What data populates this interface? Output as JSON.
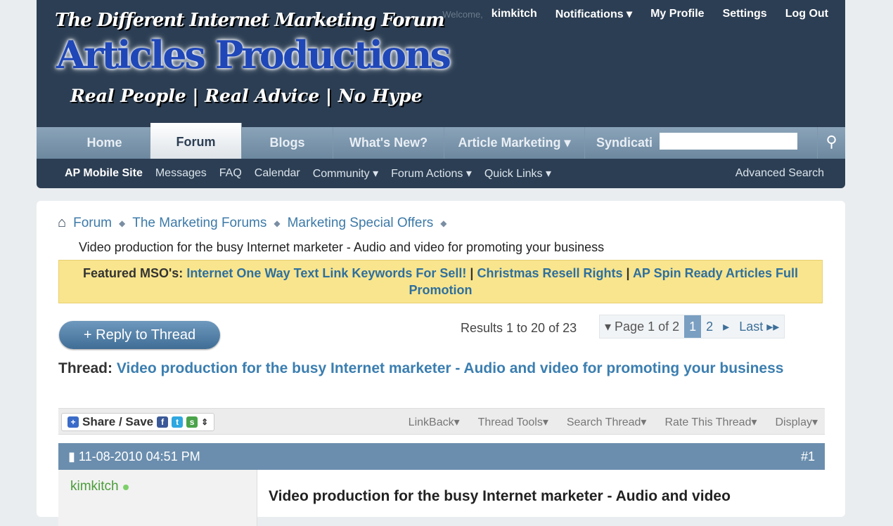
{
  "header": {
    "tagline_top": "The Different Internet Marketing Forum",
    "logo": "Articles Productions",
    "tagline_bottom": "Real People | Real Advice | No Hype",
    "welcome": "Welcome,",
    "username": "kimkitch",
    "notifications": "Notifications ▾",
    "my_profile": "My Profile",
    "settings": "Settings",
    "logout": "Log Out"
  },
  "nav": {
    "items": [
      "Home",
      "Forum",
      "Blogs",
      "What's New?",
      "Article Marketing ▾",
      "Syndicati"
    ],
    "search_placeholder": ""
  },
  "subnav": {
    "items": [
      "AP Mobile Site",
      "Messages",
      "FAQ",
      "Calendar",
      "Community ▾",
      "Forum Actions ▾",
      "Quick Links ▾"
    ],
    "advanced_search": "Advanced Search"
  },
  "breadcrumb": {
    "items": [
      "Forum",
      "The Marketing Forums",
      "Marketing Special Offers"
    ],
    "current": "Video production for the busy Internet marketer - Audio and video for promoting your business"
  },
  "featured": {
    "label": "Featured MSO's:",
    "links": [
      "Internet One Way Text Link Keywords For Sell!",
      "Christmas Resell Rights",
      "AP Spin Ready Articles Full Promotion"
    ],
    "separator": "|"
  },
  "reply_button": "+ Reply to Thread",
  "results": "Results 1 to 20 of 23",
  "pager": {
    "label": "▾ Page 1 of 2",
    "pages": [
      "1",
      "2"
    ],
    "next": "▸",
    "last": "Last ▸▸"
  },
  "thread": {
    "label": "Thread:",
    "title": "Video production for the busy Internet marketer - Audio and video for promoting your business"
  },
  "toolbar": {
    "share": "Share / Save",
    "tools": [
      "LinkBack▾",
      "Thread Tools▾",
      "Search Thread▾",
      "Rate This Thread▾",
      "Display▾"
    ]
  },
  "post": {
    "date": "11-08-2010 04:51 PM",
    "number": "#1",
    "author": "kimkitch",
    "title": "Video production for the busy Internet marketer - Audio and video"
  },
  "colors": {
    "header": "#2c3e53",
    "link": "#3b7eb0",
    "featured_bg": "#f9e58e",
    "post_header": "#6b8eae"
  }
}
